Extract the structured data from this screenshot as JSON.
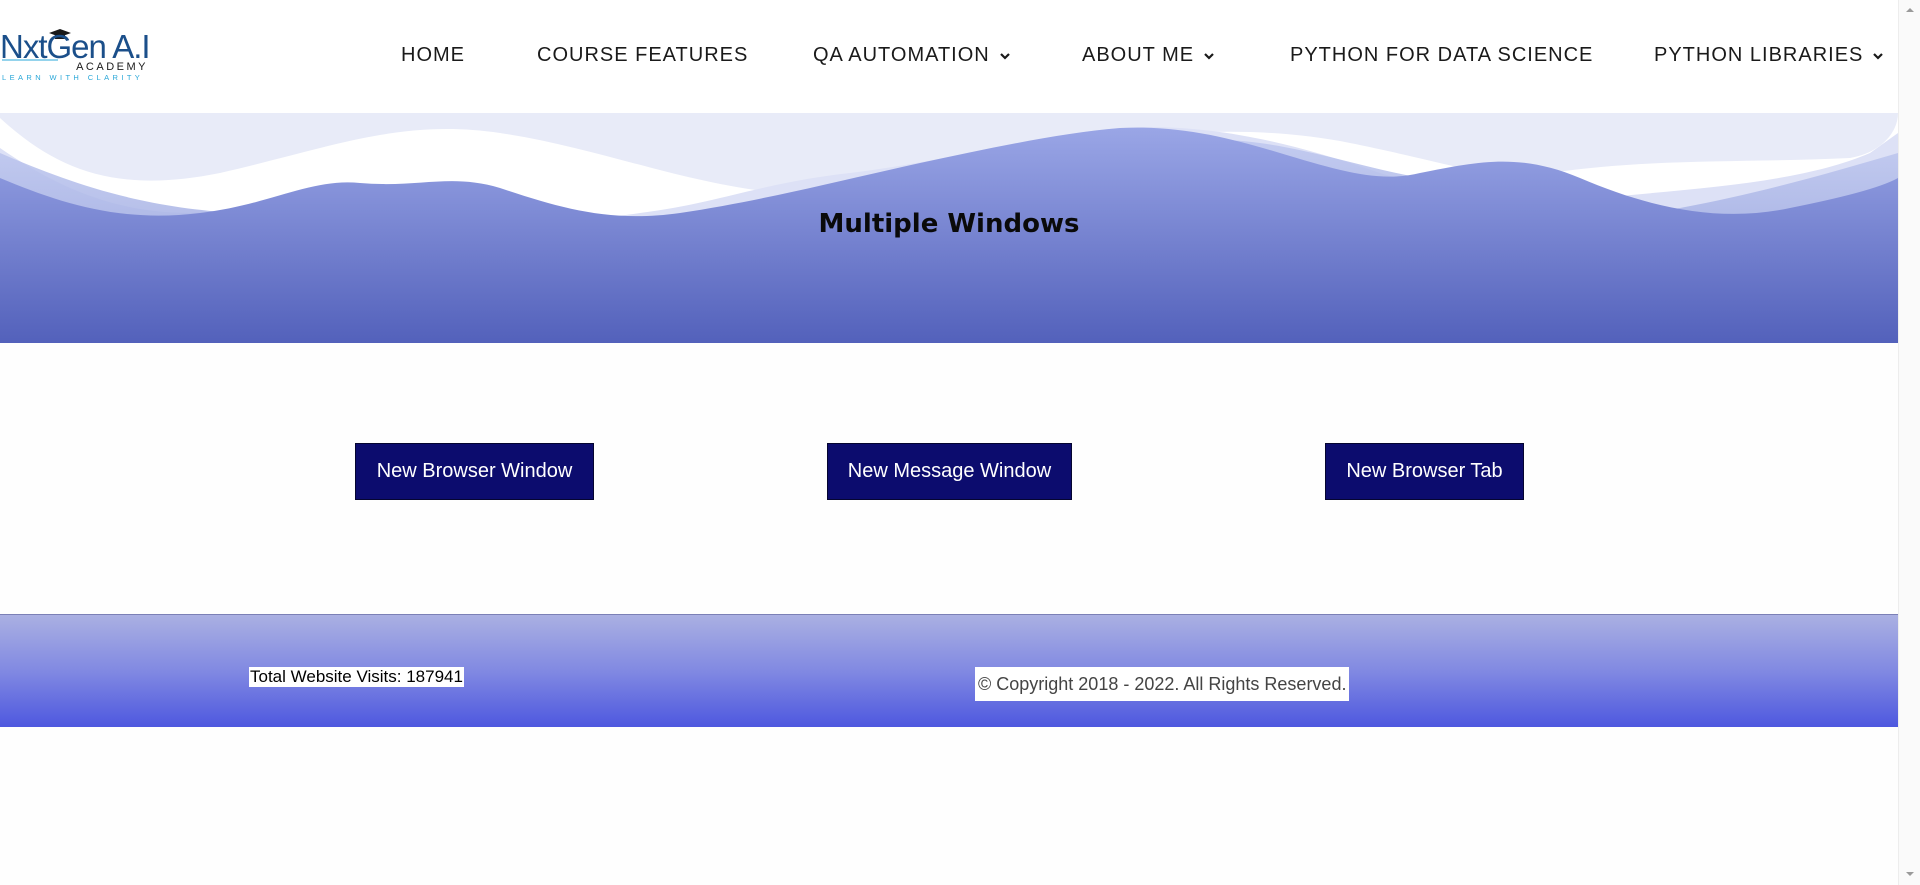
{
  "brand": {
    "name": "NxtGen A.I",
    "sub": "ACADEMY",
    "tagline": "LEARN WITH CLARITY"
  },
  "nav": {
    "items": [
      {
        "label": "HOME",
        "icon": ""
      },
      {
        "label": "COURSE FEATURES",
        "icon": ""
      },
      {
        "label": "QA AUTOMATION",
        "icon": "chevron-down-icon"
      },
      {
        "label": "ABOUT ME",
        "icon": "chevron-down-icon"
      },
      {
        "label": "PYTHON FOR DATA SCIENCE",
        "icon": ""
      },
      {
        "label": "PYTHON LIBRARIES",
        "icon": "chevron-down-icon"
      }
    ]
  },
  "banner": {
    "title": "Multiple Windows"
  },
  "buttons": {
    "browser_window": "New Browser Window",
    "message_window": "New Message Window",
    "browser_tab": "New Browser Tab"
  },
  "footer": {
    "visits": "Total Website Visits: 187941",
    "copyright": "© Copyright 2018 - 2022. All Rights Reserved."
  },
  "colors": {
    "button_bg": "#0c0c6e",
    "banner_dark": "#5563bd",
    "footer_bottom": "#4e58df",
    "logo_blue": "#1b4f8a",
    "logo_cyan": "#2aa7d8"
  }
}
